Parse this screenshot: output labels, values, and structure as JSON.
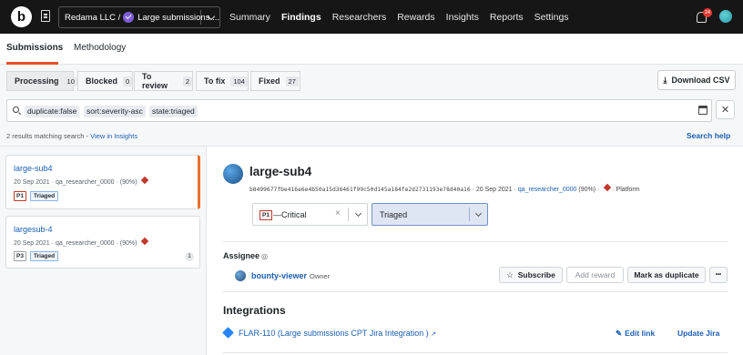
{
  "topbar": {
    "logo_letter": "b",
    "org_label": "Redama LLC / ",
    "program_label": "Large submissions ...",
    "nav": [
      "Summary",
      "Findings",
      "Researchers",
      "Rewards",
      "Insights",
      "Reports",
      "Settings"
    ],
    "active_nav": "Findings",
    "notification_count": "24"
  },
  "subnav": {
    "tabs": [
      "Submissions",
      "Methodology"
    ],
    "active": "Submissions"
  },
  "filters": {
    "tabs": [
      {
        "label": "Processing",
        "count": "10"
      },
      {
        "label": "Blocked",
        "count": "0"
      },
      {
        "label": "To review",
        "count": "2"
      },
      {
        "label": "To fix",
        "count": "104"
      },
      {
        "label": "Fixed",
        "count": "27"
      }
    ],
    "active": "Processing",
    "download_label": "Download CSV"
  },
  "search": {
    "chips": [
      "duplicate:false",
      "sort:severity-asc",
      "state:triaged"
    ],
    "clear_label": "✕"
  },
  "status": {
    "match_text": "2 results matching search - ",
    "insights_link": "View in Insights",
    "help_label": "Search help"
  },
  "submissions": [
    {
      "title": "large-sub4",
      "date": "20 Sep 2021",
      "researcher": "qa_researcher_0000",
      "accuracy": "(90%)",
      "priority": "P1",
      "state": "Triaged",
      "comments": ""
    },
    {
      "title": "largesub-4",
      "date": "20 Sep 2021",
      "researcher": "qa_researcher_0000",
      "accuracy": "(90%)",
      "priority": "P3",
      "state": "Triaged",
      "comments": "1"
    }
  ],
  "detail": {
    "title": "large-sub4",
    "hash": "b8499677fbe416e6e4b50a15d36461f99c50d145a184fe2d2731193e78d40a16",
    "date": "20 Sep 2021",
    "researcher": "qa_researcher_0000",
    "accuracy": "(90%)",
    "target": "Platform",
    "severity_code": "P1",
    "severity_label": "—Critical",
    "state_value": "Triaged",
    "assignee_heading": "Assignee",
    "assignee_name": "bounty-viewer",
    "assignee_role": "Owner",
    "buttons": {
      "subscribe": "Subscribe",
      "add_reward": "Add reward",
      "duplicate": "Mark as duplicate",
      "more": "•••"
    },
    "integrations_heading": "Integrations",
    "jira_link": "FLAR-110 (Large submissions CPT Jira Integration )",
    "edit_link": "Edit link",
    "update_jira": "Update Jira"
  },
  "colors": {
    "accent": "#e8512a",
    "link": "#1a5fb4",
    "topbar": "#161616"
  }
}
